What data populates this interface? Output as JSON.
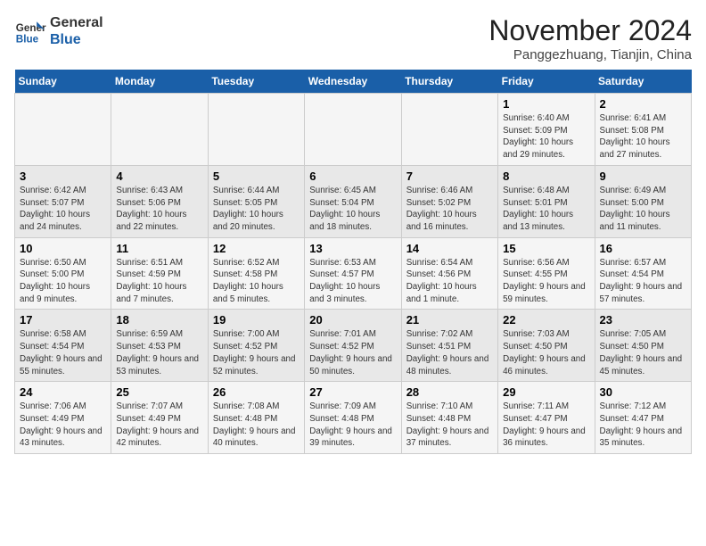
{
  "header": {
    "logo_line1": "General",
    "logo_line2": "Blue",
    "title": "November 2024",
    "subtitle": "Panggezhuang, Tianjin, China"
  },
  "weekdays": [
    "Sunday",
    "Monday",
    "Tuesday",
    "Wednesday",
    "Thursday",
    "Friday",
    "Saturday"
  ],
  "weeks": [
    [
      {
        "day": "",
        "info": ""
      },
      {
        "day": "",
        "info": ""
      },
      {
        "day": "",
        "info": ""
      },
      {
        "day": "",
        "info": ""
      },
      {
        "day": "",
        "info": ""
      },
      {
        "day": "1",
        "info": "Sunrise: 6:40 AM\nSunset: 5:09 PM\nDaylight: 10 hours and 29 minutes."
      },
      {
        "day": "2",
        "info": "Sunrise: 6:41 AM\nSunset: 5:08 PM\nDaylight: 10 hours and 27 minutes."
      }
    ],
    [
      {
        "day": "3",
        "info": "Sunrise: 6:42 AM\nSunset: 5:07 PM\nDaylight: 10 hours and 24 minutes."
      },
      {
        "day": "4",
        "info": "Sunrise: 6:43 AM\nSunset: 5:06 PM\nDaylight: 10 hours and 22 minutes."
      },
      {
        "day": "5",
        "info": "Sunrise: 6:44 AM\nSunset: 5:05 PM\nDaylight: 10 hours and 20 minutes."
      },
      {
        "day": "6",
        "info": "Sunrise: 6:45 AM\nSunset: 5:04 PM\nDaylight: 10 hours and 18 minutes."
      },
      {
        "day": "7",
        "info": "Sunrise: 6:46 AM\nSunset: 5:02 PM\nDaylight: 10 hours and 16 minutes."
      },
      {
        "day": "8",
        "info": "Sunrise: 6:48 AM\nSunset: 5:01 PM\nDaylight: 10 hours and 13 minutes."
      },
      {
        "day": "9",
        "info": "Sunrise: 6:49 AM\nSunset: 5:00 PM\nDaylight: 10 hours and 11 minutes."
      }
    ],
    [
      {
        "day": "10",
        "info": "Sunrise: 6:50 AM\nSunset: 5:00 PM\nDaylight: 10 hours and 9 minutes."
      },
      {
        "day": "11",
        "info": "Sunrise: 6:51 AM\nSunset: 4:59 PM\nDaylight: 10 hours and 7 minutes."
      },
      {
        "day": "12",
        "info": "Sunrise: 6:52 AM\nSunset: 4:58 PM\nDaylight: 10 hours and 5 minutes."
      },
      {
        "day": "13",
        "info": "Sunrise: 6:53 AM\nSunset: 4:57 PM\nDaylight: 10 hours and 3 minutes."
      },
      {
        "day": "14",
        "info": "Sunrise: 6:54 AM\nSunset: 4:56 PM\nDaylight: 10 hours and 1 minute."
      },
      {
        "day": "15",
        "info": "Sunrise: 6:56 AM\nSunset: 4:55 PM\nDaylight: 9 hours and 59 minutes."
      },
      {
        "day": "16",
        "info": "Sunrise: 6:57 AM\nSunset: 4:54 PM\nDaylight: 9 hours and 57 minutes."
      }
    ],
    [
      {
        "day": "17",
        "info": "Sunrise: 6:58 AM\nSunset: 4:54 PM\nDaylight: 9 hours and 55 minutes."
      },
      {
        "day": "18",
        "info": "Sunrise: 6:59 AM\nSunset: 4:53 PM\nDaylight: 9 hours and 53 minutes."
      },
      {
        "day": "19",
        "info": "Sunrise: 7:00 AM\nSunset: 4:52 PM\nDaylight: 9 hours and 52 minutes."
      },
      {
        "day": "20",
        "info": "Sunrise: 7:01 AM\nSunset: 4:52 PM\nDaylight: 9 hours and 50 minutes."
      },
      {
        "day": "21",
        "info": "Sunrise: 7:02 AM\nSunset: 4:51 PM\nDaylight: 9 hours and 48 minutes."
      },
      {
        "day": "22",
        "info": "Sunrise: 7:03 AM\nSunset: 4:50 PM\nDaylight: 9 hours and 46 minutes."
      },
      {
        "day": "23",
        "info": "Sunrise: 7:05 AM\nSunset: 4:50 PM\nDaylight: 9 hours and 45 minutes."
      }
    ],
    [
      {
        "day": "24",
        "info": "Sunrise: 7:06 AM\nSunset: 4:49 PM\nDaylight: 9 hours and 43 minutes."
      },
      {
        "day": "25",
        "info": "Sunrise: 7:07 AM\nSunset: 4:49 PM\nDaylight: 9 hours and 42 minutes."
      },
      {
        "day": "26",
        "info": "Sunrise: 7:08 AM\nSunset: 4:48 PM\nDaylight: 9 hours and 40 minutes."
      },
      {
        "day": "27",
        "info": "Sunrise: 7:09 AM\nSunset: 4:48 PM\nDaylight: 9 hours and 39 minutes."
      },
      {
        "day": "28",
        "info": "Sunrise: 7:10 AM\nSunset: 4:48 PM\nDaylight: 9 hours and 37 minutes."
      },
      {
        "day": "29",
        "info": "Sunrise: 7:11 AM\nSunset: 4:47 PM\nDaylight: 9 hours and 36 minutes."
      },
      {
        "day": "30",
        "info": "Sunrise: 7:12 AM\nSunset: 4:47 PM\nDaylight: 9 hours and 35 minutes."
      }
    ]
  ]
}
